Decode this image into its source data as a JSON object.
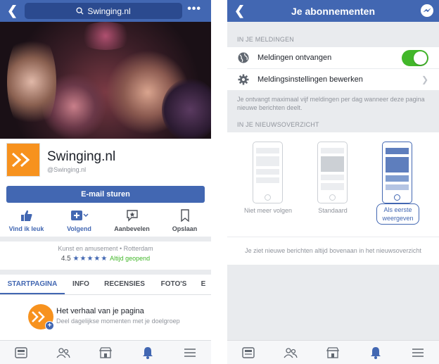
{
  "left": {
    "search": {
      "value": "Swinging.nl"
    },
    "page": {
      "name": "Swinging.nl",
      "handle": "@Swinging.nl",
      "logo_text": ">>"
    },
    "email_button": "E-mail sturen",
    "actions": [
      {
        "label": "Vind ik leuk",
        "icon": "thumbs-up-icon"
      },
      {
        "label": "Volgend",
        "icon": "follow-icon"
      },
      {
        "label": "Aanbevelen",
        "icon": "recommend-icon"
      },
      {
        "label": "Opslaan",
        "icon": "bookmark-icon"
      }
    ],
    "category": "Kunst en amusement • Rotterdam",
    "rating": {
      "score": "4.5",
      "stars": "★★★★★",
      "open": "Altijd geopend"
    },
    "tabs": [
      "STARTPAGINA",
      "INFO",
      "RECENSIES",
      "FOTO'S",
      "E"
    ],
    "story": {
      "title": "Het verhaal van je pagina",
      "subtitle": "Deel dagelijkse momenten met je doelgroep"
    }
  },
  "right": {
    "title": "Je abonnementen",
    "section1": "IN JE MELDINGEN",
    "row1": "Meldingen ontvangen",
    "row2": "Meldingsinstellingen bewerken",
    "note": "Je ontvangt maximaal vijf meldingen per dag wanneer deze pagina nieuwe berichten deelt.",
    "section2": "IN JE NIEUWSOVERZICHT",
    "options": [
      "Niet meer volgen",
      "Standaard",
      "Als eerste weergeven"
    ],
    "footer": "Je ziet nieuwe berichten altijd bovenaan in het nieuwsoverzicht"
  },
  "colors": {
    "brand": "#4267b2",
    "accent_orange": "#f7921e",
    "toggle_on": "#42b72a"
  }
}
